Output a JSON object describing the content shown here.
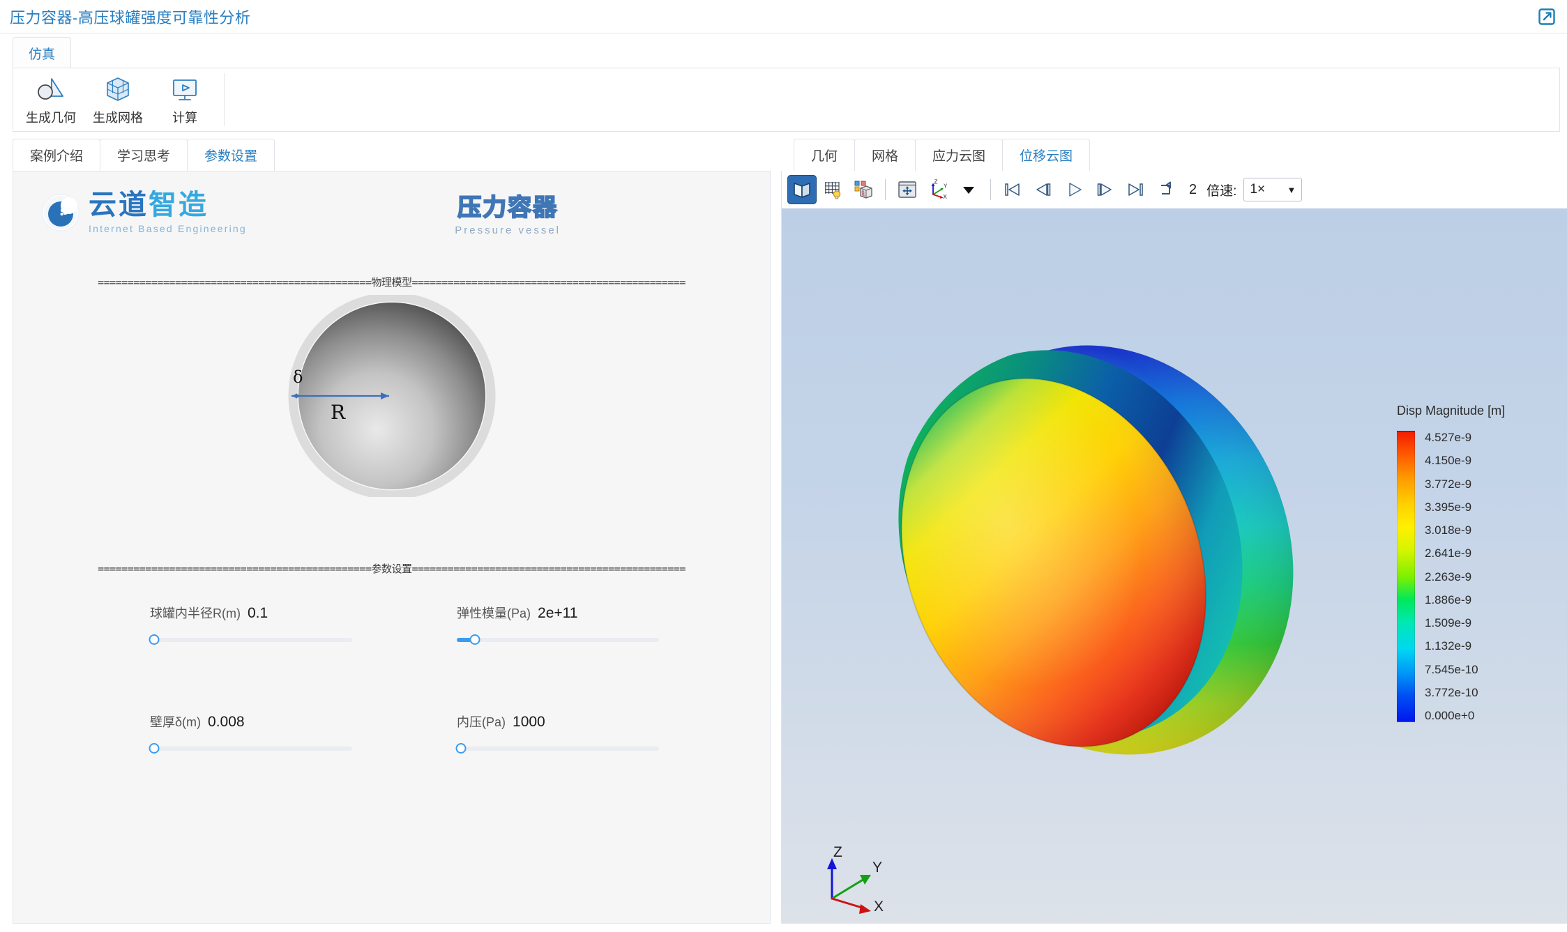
{
  "window": {
    "title": "压力容器-高压球罐强度可靠性分析",
    "external_link_icon": "external-link-icon"
  },
  "ribbon": {
    "tabs": [
      {
        "label": "仿真",
        "active": true
      }
    ],
    "buttons": [
      {
        "label": "生成几何",
        "icon": "geometry-icon"
      },
      {
        "label": "生成网格",
        "icon": "mesh-cube-icon"
      },
      {
        "label": "计算",
        "icon": "compute-monitor-icon"
      }
    ]
  },
  "left_panel": {
    "tabs": [
      {
        "label": "案例介绍",
        "active": false
      },
      {
        "label": "学习思考",
        "active": false
      },
      {
        "label": "参数设置",
        "active": true
      }
    ],
    "logo": {
      "cn_part1": "云道",
      "cn_part2": "智造",
      "en": "Internet Based Engineering"
    },
    "case_logo": {
      "cn": "压力容器",
      "en": "Pressure vessel"
    },
    "sections": [
      {
        "equals": "==============================================",
        "title": "物理模型"
      },
      {
        "equals": "==============================================",
        "title": "参数设置"
      }
    ],
    "figure": {
      "radius_label": "R",
      "thickness_label": "δ"
    },
    "parameters": [
      {
        "name": "球罐内半径R(m)",
        "value": "0.1",
        "fill_percent": 0,
        "knob_percent": 2
      },
      {
        "name": "弹性模量(Pa)",
        "value": "2e+11",
        "fill_percent": 9,
        "knob_percent": 9
      },
      {
        "name": "壁厚δ(m)",
        "value": "0.008",
        "fill_percent": 0,
        "knob_percent": 2
      },
      {
        "name": "内压(Pa)",
        "value": "1000",
        "fill_percent": 0,
        "knob_percent": 2
      }
    ]
  },
  "right_panel": {
    "tabs": [
      {
        "label": "几何",
        "active": false
      },
      {
        "label": "网格",
        "active": false
      },
      {
        "label": "应力云图",
        "active": false
      },
      {
        "label": "位移云图",
        "active": true
      }
    ],
    "toolbar": {
      "buttons": [
        {
          "icon": "solid-shading-icon",
          "active": true
        },
        {
          "icon": "mesh-light-icon",
          "active": false
        },
        {
          "icon": "contour-cube-icon",
          "active": false
        },
        {
          "icon": "fit-view-icon",
          "active": false
        },
        {
          "icon": "axis-orientation-icon",
          "active": false
        },
        {
          "icon": "dropdown-caret-icon",
          "active": false
        }
      ],
      "playback": [
        {
          "icon": "skip-first-icon"
        },
        {
          "icon": "step-back-icon"
        },
        {
          "icon": "play-icon"
        },
        {
          "icon": "step-forward-icon"
        },
        {
          "icon": "skip-last-icon"
        },
        {
          "icon": "loop-icon"
        }
      ],
      "frame_number": "2",
      "speed_label": "倍速:",
      "speed_value": "1×"
    },
    "legend": {
      "title": "Disp Magnitude [m]",
      "ticks": [
        "4.527e-9",
        "4.150e-9",
        "3.772e-9",
        "3.395e-9",
        "3.018e-9",
        "2.641e-9",
        "2.263e-9",
        "1.886e-9",
        "1.509e-9",
        "1.132e-9",
        "7.545e-10",
        "3.772e-10",
        "0.000e+0"
      ]
    },
    "axis_triad": {
      "x": "X",
      "y": "Y",
      "z": "Z"
    }
  },
  "colors": {
    "accent": "#2a7fc1",
    "slider_fill": "#3b9bf0",
    "toolbar_active": "#2e6db4",
    "viewport_top": "#bccfe6",
    "viewport_bottom": "#dde2e9"
  }
}
